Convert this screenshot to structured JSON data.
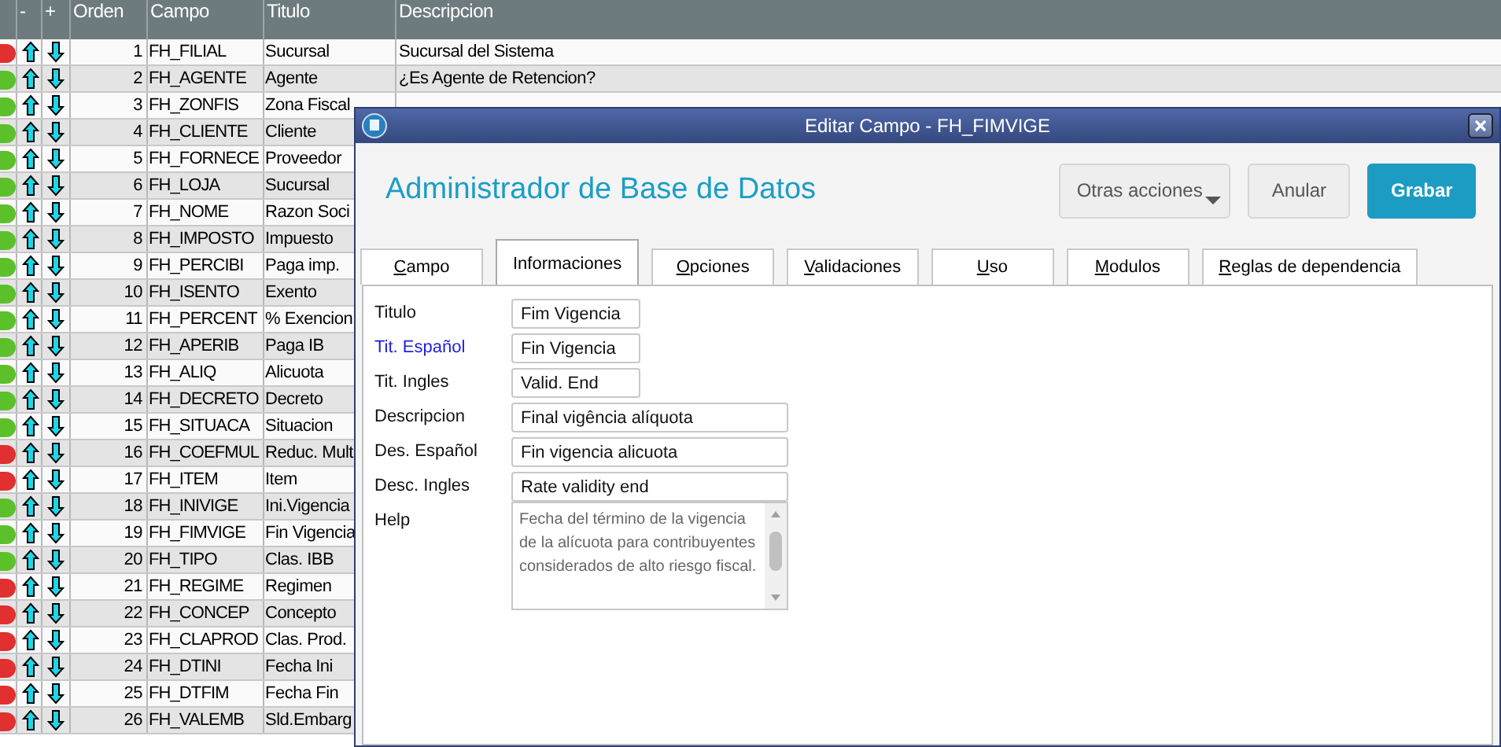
{
  "grid": {
    "columns": [
      "-",
      "+",
      "Orden",
      "Campo",
      "Titulo",
      "Descripcion"
    ],
    "rows": [
      {
        "color": "#e03030",
        "orden": "1",
        "campo": "FH_FILIAL",
        "titulo": "Sucursal",
        "descripcion": "Sucursal del Sistema"
      },
      {
        "color": "#5cc02a",
        "orden": "2",
        "campo": "FH_AGENTE",
        "titulo": "Agente",
        "descripcion": "¿Es Agente de Retencion?"
      },
      {
        "color": "#5cc02a",
        "orden": "3",
        "campo": "FH_ZONFIS",
        "titulo": "Zona Fiscal"
      },
      {
        "color": "#5cc02a",
        "orden": "4",
        "campo": "FH_CLIENTE",
        "titulo": "Cliente"
      },
      {
        "color": "#5cc02a",
        "orden": "5",
        "campo": "FH_FORNECE",
        "titulo": "Proveedor"
      },
      {
        "color": "#5cc02a",
        "orden": "6",
        "campo": "FH_LOJA",
        "titulo": "Sucursal"
      },
      {
        "color": "#5cc02a",
        "orden": "7",
        "campo": "FH_NOME",
        "titulo": "Razon Soci"
      },
      {
        "color": "#5cc02a",
        "orden": "8",
        "campo": "FH_IMPOSTO",
        "titulo": "Impuesto"
      },
      {
        "color": "#5cc02a",
        "orden": "9",
        "campo": "FH_PERCIBI",
        "titulo": "Paga imp."
      },
      {
        "color": "#5cc02a",
        "orden": "10",
        "campo": "FH_ISENTO",
        "titulo": "Exento"
      },
      {
        "color": "#5cc02a",
        "orden": "11",
        "campo": "FH_PERCENT",
        "titulo": "% Exencion"
      },
      {
        "color": "#5cc02a",
        "orden": "12",
        "campo": "FH_APERIB",
        "titulo": "Paga IB"
      },
      {
        "color": "#5cc02a",
        "orden": "13",
        "campo": "FH_ALIQ",
        "titulo": "Alicuota"
      },
      {
        "color": "#5cc02a",
        "orden": "14",
        "campo": "FH_DECRETO",
        "titulo": "Decreto"
      },
      {
        "color": "#5cc02a",
        "orden": "15",
        "campo": "FH_SITUACA",
        "titulo": "Situacion"
      },
      {
        "color": "#e03030",
        "orden": "16",
        "campo": "FH_COEFMUL",
        "titulo": "Reduc. Mult"
      },
      {
        "color": "#e03030",
        "orden": "17",
        "campo": "FH_ITEM",
        "titulo": "Item"
      },
      {
        "color": "#5cc02a",
        "orden": "18",
        "campo": "FH_INIVIGE",
        "titulo": "Ini.Vigencia"
      },
      {
        "color": "#5cc02a",
        "orden": "19",
        "campo": "FH_FIMVIGE",
        "titulo": "Fin Vigencia"
      },
      {
        "color": "#5cc02a",
        "orden": "20",
        "campo": "FH_TIPO",
        "titulo": "Clas. IBB"
      },
      {
        "color": "#e03030",
        "orden": "21",
        "campo": "FH_REGIME",
        "titulo": "Regimen"
      },
      {
        "color": "#e03030",
        "orden": "22",
        "campo": "FH_CONCEP",
        "titulo": "Concepto"
      },
      {
        "color": "#e03030",
        "orden": "23",
        "campo": "FH_CLAPROD",
        "titulo": "Clas. Prod."
      },
      {
        "color": "#e03030",
        "orden": "24",
        "campo": "FH_DTINI",
        "titulo": "Fecha Ini"
      },
      {
        "color": "#e03030",
        "orden": "25",
        "campo": "FH_DTFIM",
        "titulo": "Fecha Fin"
      },
      {
        "color": "#e03030",
        "orden": "26",
        "campo": "FH_VALEMB",
        "titulo": "Sld.Embarg"
      }
    ]
  },
  "dialog": {
    "title": "Editar Campo - FH_FIMVIGE",
    "heading": "Administrador de Base de Datos",
    "buttons": [
      {
        "label": "Otras acciones",
        "kind": "menu"
      },
      {
        "label": "Anular",
        "kind": "plain"
      },
      {
        "label": "Grabar",
        "kind": "primary"
      }
    ],
    "tabs": [
      {
        "label": "Campo",
        "selected": false
      },
      {
        "label": "Informaciones",
        "selected": true
      },
      {
        "label": "Opciones",
        "selected": false
      },
      {
        "label": "Validaciones",
        "selected": false
      },
      {
        "label": "Uso",
        "selected": false
      },
      {
        "label": "Modulos",
        "selected": false
      },
      {
        "label": "Reglas de dependencia",
        "selected": false
      }
    ],
    "fields": [
      {
        "label": "Titulo",
        "value": "Fim Vigencia",
        "highlighted": false,
        "kind": "short"
      },
      {
        "label": "Tit. Español",
        "value": "Fin Vigencia",
        "highlighted": true,
        "kind": "short"
      },
      {
        "label": "Tit. Ingles",
        "value": "Valid. End",
        "highlighted": false,
        "kind": "short"
      },
      {
        "label": "Descripcion",
        "value": "Final vigência alíquota",
        "highlighted": false,
        "kind": "long"
      },
      {
        "label": "Des. Español",
        "value": "Fin vigencia alicuota",
        "highlighted": false,
        "kind": "long"
      },
      {
        "label": "Desc. Ingles",
        "value": "Rate validity end",
        "highlighted": false,
        "kind": "long"
      },
      {
        "label": "Help",
        "value": "Fecha del término de la vigencia de la alícuota para contribuyentes considerados de alto riesgo fiscal.",
        "highlighted": false,
        "kind": "memo"
      }
    ]
  }
}
